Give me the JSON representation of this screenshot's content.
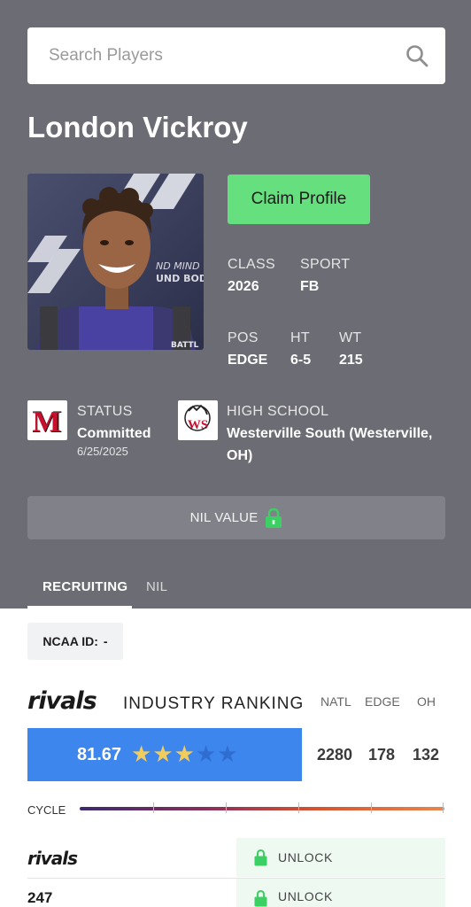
{
  "search": {
    "placeholder": "Search Players"
  },
  "player": {
    "name": "London Vickroy"
  },
  "actions": {
    "claim_label": "Claim Profile"
  },
  "stats": {
    "class_label": "CLASS",
    "class_value": "2026",
    "sport_label": "SPORT",
    "sport_value": "FB",
    "pos_label": "POS",
    "pos_value": "EDGE",
    "ht_label": "HT",
    "ht_value": "6-5",
    "wt_label": "WT",
    "wt_value": "215"
  },
  "status": {
    "label": "STATUS",
    "value": "Committed",
    "date": "6/25/2025",
    "school_logo_letter": "M"
  },
  "high_school": {
    "label": "HIGH SCHOOL",
    "line1": "Westerville South (Westerville,",
    "line2": "OH)",
    "logo_text": "WS"
  },
  "nil": {
    "label": "NIL VALUE"
  },
  "tabs": [
    {
      "label": "RECRUITING",
      "active": true
    },
    {
      "label": "NIL",
      "active": false
    }
  ],
  "ncaa": {
    "label": "NCAA ID:",
    "value": "-"
  },
  "ranking": {
    "brand": "rivals",
    "title": "INDUSTRY RANKING",
    "columns": [
      "NATL",
      "EDGE",
      "OH"
    ],
    "score": "81.67",
    "stars_filled": 3,
    "stars_total": 5,
    "ranks": [
      "2280",
      "178",
      "132"
    ],
    "cycle_label": "CYCLE"
  },
  "services": [
    {
      "name": "rivals",
      "action": "UNLOCK"
    },
    {
      "name": "247",
      "action": "UNLOCK"
    }
  ],
  "colors": {
    "hero_bg": "#6c6d74",
    "claim_green": "#66e07f",
    "score_blue": "#3d86ee",
    "star_gold": "#f2cd5c",
    "star_empty": "#2f6dd0",
    "lock_green": "#3ccf63"
  },
  "icons": {
    "search": "search-icon",
    "lock": "lock-icon",
    "star": "star-icon"
  }
}
